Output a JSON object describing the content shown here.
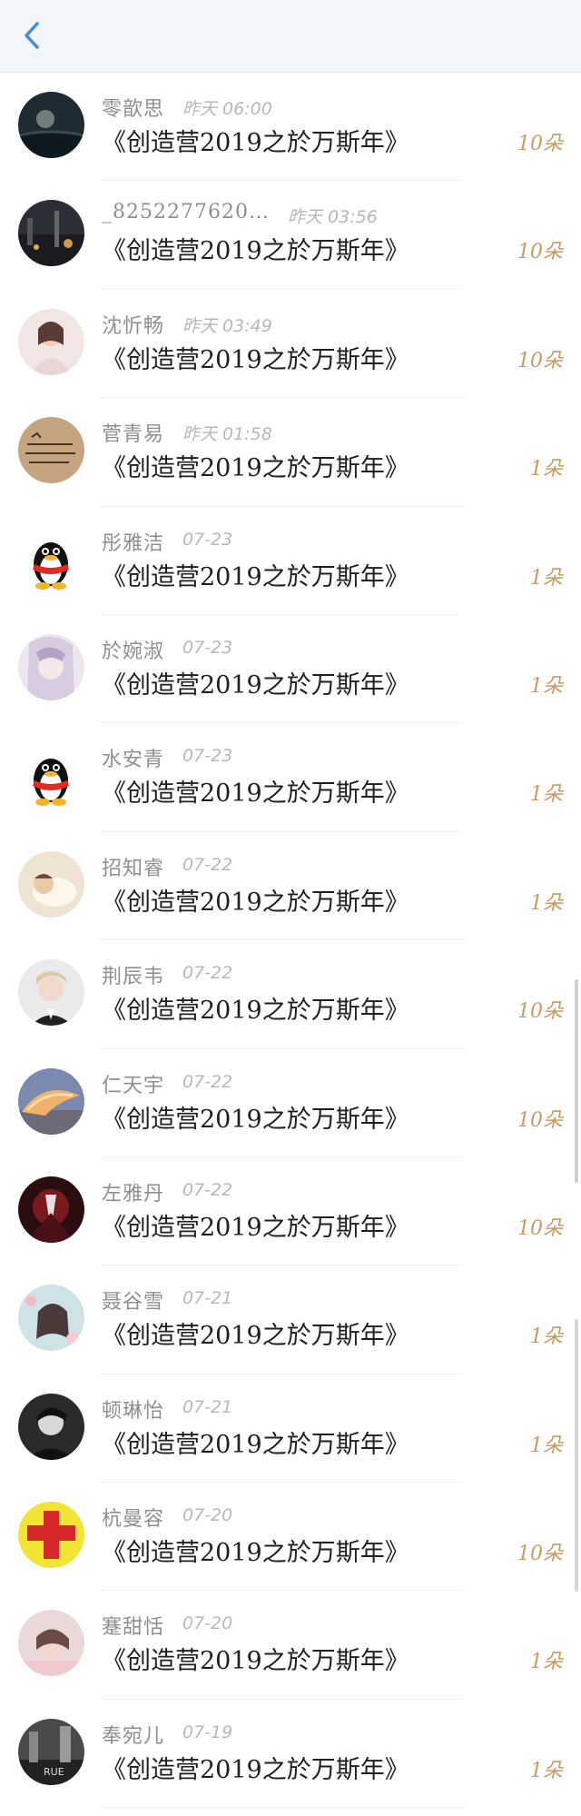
{
  "header": {
    "back_icon": "chevron-left-icon",
    "accent": "#3b8fd8"
  },
  "gift_title": "《创造营2019之於万斯年》",
  "rows": [
    {
      "name": "零歆思",
      "time": "昨天 06:00",
      "count": "10朵",
      "avatar": "night-sea"
    },
    {
      "name": "_8252277620…",
      "time": "昨天 03:56",
      "count": "10朵",
      "avatar": "city-night"
    },
    {
      "name": "沈忻畅",
      "time": "昨天 03:49",
      "count": "10朵",
      "avatar": "girl-photo"
    },
    {
      "name": "菅青易",
      "time": "昨天 01:58",
      "count": "1朵",
      "avatar": "handwriting"
    },
    {
      "name": "彤雅洁",
      "time": "07-23",
      "count": "1朵",
      "avatar": "penguin"
    },
    {
      "name": "於婉淑",
      "time": "07-23",
      "count": "1朵",
      "avatar": "anime-girl"
    },
    {
      "name": "水安青",
      "time": "07-23",
      "count": "1朵",
      "avatar": "penguin"
    },
    {
      "name": "招知睿",
      "time": "07-22",
      "count": "1朵",
      "avatar": "sleeping-baby"
    },
    {
      "name": "荆辰韦",
      "time": "07-22",
      "count": "10朵",
      "avatar": "blond-man"
    },
    {
      "name": "仁天宇",
      "time": "07-22",
      "count": "10朵",
      "avatar": "sunset-wave"
    },
    {
      "name": "左雅丹",
      "time": "07-22",
      "count": "10朵",
      "avatar": "dark-red"
    },
    {
      "name": "聂谷雪",
      "time": "07-21",
      "count": "1朵",
      "avatar": "girl-flowers"
    },
    {
      "name": "顿琳怡",
      "time": "07-21",
      "count": "1朵",
      "avatar": "mono-man"
    },
    {
      "name": "杭曼容",
      "time": "07-20",
      "count": "10朵",
      "avatar": "red-cross"
    },
    {
      "name": "蹇甜恬",
      "time": "07-20",
      "count": "1朵",
      "avatar": "girl-pink"
    },
    {
      "name": "奉宛儿",
      "time": "07-19",
      "count": "1朵",
      "avatar": "mono-street"
    }
  ]
}
